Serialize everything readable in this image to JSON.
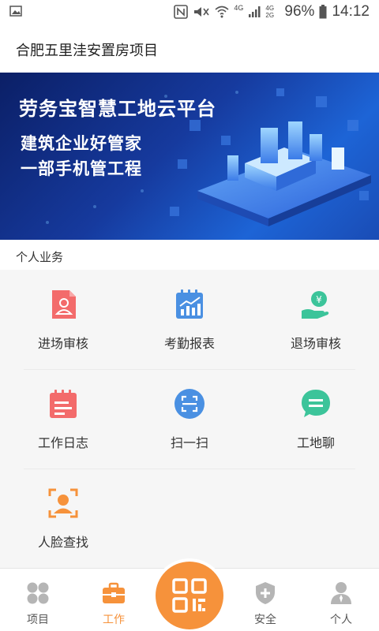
{
  "status_bar": {
    "battery": "96%",
    "time": "14:12",
    "network_labels": [
      "4G",
      "4G 2G"
    ],
    "icons": [
      "image-icon",
      "nfc-icon",
      "mute-icon",
      "wifi-icon",
      "signal-icon",
      "battery-icon"
    ]
  },
  "header": {
    "title": "合肥五里洼安置房项目"
  },
  "banner": {
    "title": "劳务宝智慧工地云平台",
    "line1": "建筑企业好管家",
    "line2": "一部手机管工程"
  },
  "section": {
    "label": "个人业务"
  },
  "tiles": [
    {
      "label": "进场审核",
      "icon": "entry-review-icon",
      "color": "#f36b6b"
    },
    {
      "label": "考勤报表",
      "icon": "attendance-report-icon",
      "color": "#4a90e2"
    },
    {
      "label": "退场审核",
      "icon": "exit-review-icon",
      "color": "#3cc49a"
    },
    {
      "label": "工作日志",
      "icon": "work-log-icon",
      "color": "#f36b6b"
    },
    {
      "label": "扫一扫",
      "icon": "scan-icon",
      "color": "#4a90e2"
    },
    {
      "label": "工地聊",
      "icon": "chat-icon",
      "color": "#3cc49a"
    },
    {
      "label": "人脸查找",
      "icon": "face-search-icon",
      "color": "#f6923b"
    }
  ],
  "bottom_nav": {
    "items": [
      {
        "label": "项目",
        "icon": "project-grid-icon"
      },
      {
        "label": "工作",
        "icon": "briefcase-icon"
      },
      {
        "label": "安全",
        "icon": "shield-icon"
      },
      {
        "label": "个人",
        "icon": "person-icon"
      }
    ],
    "active": "工作",
    "center_action": "qr-scan-icon"
  },
  "colors": {
    "accent": "#f6923b",
    "inactive_icon": "#b5b5b5"
  }
}
